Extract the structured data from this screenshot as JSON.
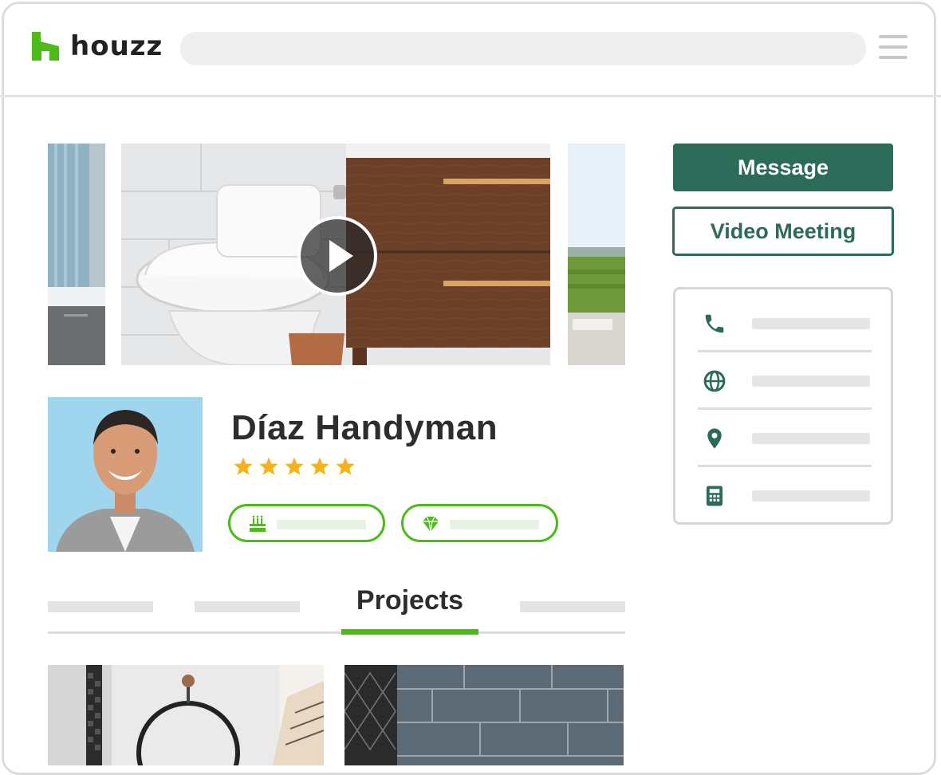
{
  "brand": {
    "name": "houzz",
    "color": "#4cbb17"
  },
  "header": {
    "search_placeholder": "",
    "menu_icon": "hamburger-icon"
  },
  "profile": {
    "name": "Díaz Handyman",
    "rating": 5,
    "rating_max": 5,
    "badges": [
      {
        "icon": "cake-icon"
      },
      {
        "icon": "diamond-icon"
      }
    ]
  },
  "tabs": {
    "active_label": "Projects"
  },
  "actions": {
    "message_label": "Message",
    "video_label": "Video Meeting",
    "accent": "#2b6b57"
  },
  "contact": [
    {
      "icon": "phone-icon"
    },
    {
      "icon": "globe-icon"
    },
    {
      "icon": "location-pin-icon"
    },
    {
      "icon": "calculator-icon"
    }
  ]
}
